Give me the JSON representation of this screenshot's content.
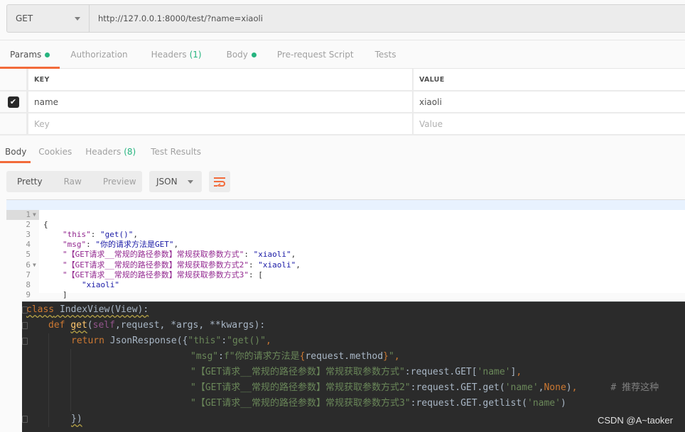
{
  "request": {
    "method": "GET",
    "url": "http://127.0.0.1:8000/test/?name=xiaoli"
  },
  "request_tabs": [
    {
      "label": "Params",
      "dot": true,
      "active": true
    },
    {
      "label": "Authorization"
    },
    {
      "label": "Headers",
      "count": "(1)"
    },
    {
      "label": "Body",
      "dot": true
    },
    {
      "label": "Pre-request Script"
    },
    {
      "label": "Tests"
    }
  ],
  "params": {
    "headers": {
      "key": "KEY",
      "value": "VALUE"
    },
    "rows": [
      {
        "checked": true,
        "key": "name",
        "value": "xiaoli"
      }
    ],
    "placeholder": {
      "key": "Key",
      "value": "Value"
    }
  },
  "response_tabs": [
    {
      "label": "Body",
      "active": true
    },
    {
      "label": "Cookies"
    },
    {
      "label": "Headers",
      "count": "(8)"
    },
    {
      "label": "Test Results"
    }
  ],
  "response_toolbar": {
    "views": [
      "Pretty",
      "Raw",
      "Preview"
    ],
    "active_view": "Pretty",
    "format": "JSON",
    "wrap_icon": "wrap-lines-icon"
  },
  "response_body": {
    "lines": [
      {
        "n": "1",
        "fold": true
      },
      {
        "n": "2"
      },
      {
        "n": "3"
      },
      {
        "n": "4"
      },
      {
        "n": "5"
      },
      {
        "n": "6",
        "fold": true
      },
      {
        "n": "7"
      },
      {
        "n": "8"
      },
      {
        "n": "9"
      }
    ],
    "k_this": "\"this\"",
    "v_this": "\"get()\"",
    "k_msg": "\"msg\"",
    "v_msg": "\"你的请求方法是GET\"",
    "k_1": "\"【GET请求__常规的路径参数】常规获取参数方式\"",
    "v_1": "\"xiaoli\"",
    "k_2": "\"【GET请求__常规的路径参数】常规获取参数方式2\"",
    "v_2": "\"xiaoli\"",
    "k_3": "\"【GET请求__常规的路径参数】常规获取参数方式3\"",
    "v_3_item": "\"xiaoli\""
  },
  "code": {
    "l1_kw": "class",
    "l1_rest": " IndexView(View):",
    "l2_kw": "def",
    "l2_fn": "get",
    "l2_self": "self",
    "l2_rest": ",request, *args, **kwargs):",
    "l3_kw": "return",
    "l3_call": " JsonResponse({",
    "l3_k": "\"this\"",
    "l3_v": "\"get()\"",
    "l4_k": "\"msg\"",
    "l4_f": "f\"你的请求方法是",
    "l4_expr": "request.method",
    "l4_end": "\"",
    "l5_k": "\"【GET请求__常规的路径参数】常规获取参数方式\"",
    "l5_v1": "request.GET[",
    "l5_s": "'name'",
    "l5_v2": "]",
    "l6_k": "\"【GET请求__常规的路径参数】常规获取参数方式2\"",
    "l6_v1": "request.GET.get(",
    "l6_s": "'name'",
    "l6_none": "None",
    "l6_v2": ")",
    "l6_comment": "# 推荐这种",
    "l7_k": "\"【GET请求__常规的路径参数】常规获取参数方式3\"",
    "l7_v1": "request.GET.getlist(",
    "l7_s": "'name'",
    "l7_v2": ")",
    "l8": "})"
  },
  "watermark": "CSDN @A~taoker",
  "colors": {
    "accent": "#f26b3a",
    "count_green": "#26b47f"
  }
}
